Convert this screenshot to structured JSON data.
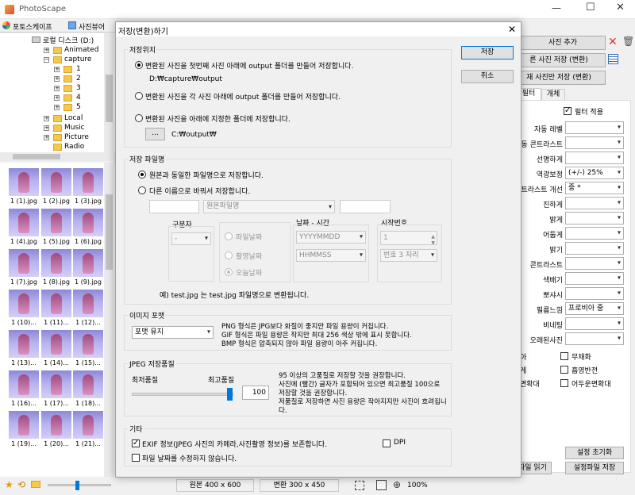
{
  "app": {
    "title": "PhotoScape",
    "tabs": [
      "포토스케이프",
      "사진뷰어"
    ]
  },
  "tree": {
    "drive": "로컬 디스크 (D:)",
    "items": [
      "Animated",
      "capture",
      "1",
      "2",
      "3",
      "4",
      "5",
      "Local",
      "Music",
      "Picture",
      "Radio"
    ]
  },
  "thumbs": [
    "1 (1).jpg",
    "1 (2).jpg",
    "1 (3).jpg",
    "1 (4).jpg",
    "1 (5).jpg",
    "1 (6).jpg",
    "1 (7).jpg",
    "1 (8).jpg",
    "1 (9).jpg",
    "1 (10)...",
    "1 (11)...",
    "1 (12)...",
    "1 (13)...",
    "1 (14)...",
    "1 (15)...",
    "1 (16)...",
    "1 (17)...",
    "1 (18)...",
    "1 (19)...",
    "1 (20)...",
    "1 (21)..."
  ],
  "status": {
    "original": "원본 400 x 600",
    "converted": "변환 300 x 450",
    "zoom": "100%"
  },
  "right": {
    "buttons": [
      "사진 추가",
      "른 사진 저장 (변환)",
      "재 사진만 저장 (변환)"
    ],
    "tabs": [
      "필터",
      "개체"
    ],
    "filter_check": "필터 적용",
    "rows": [
      {
        "label": "자동 레벨",
        "value": ""
      },
      {
        "label": "동 콘트라스트",
        "value": ""
      },
      {
        "label": "선명하게",
        "value": ""
      },
      {
        "label": "역광보정",
        "value": "(+/-) 25%"
      },
      {
        "label": "콘트라스트 개선",
        "value": "중 *"
      },
      {
        "label": "진하게",
        "value": ""
      },
      {
        "label": "밝게",
        "value": ""
      },
      {
        "label": "어둡게",
        "value": ""
      },
      {
        "label": "밝기",
        "value": ""
      },
      {
        "label": "콘트라스트",
        "value": ""
      },
      {
        "label": "색배기",
        "value": ""
      },
      {
        "label": "뽀샤시",
        "value": ""
      },
      {
        "label": "필름느낌",
        "value": "프로비아 중"
      },
      {
        "label": "비네팅",
        "value": ""
      },
      {
        "label": "오래된사진",
        "value": ""
      }
    ],
    "checks_left": [
      "아",
      "게",
      "면확대"
    ],
    "checks_right": [
      "무채화",
      "흡영반전",
      "어두운면확대"
    ],
    "bottom_buttons": [
      "설정 초기화",
      "파일 읽기",
      "설정파일 저장"
    ]
  },
  "dialog": {
    "title": "저장(변환)하기",
    "save": "저장",
    "cancel": "취소",
    "location": {
      "title": "저장위치",
      "opt1": "변환된 사진을 첫번째 사진 아래에 output 폴더를 만들어 저장합니다.",
      "path1": "D:₩capture₩output",
      "opt2": "변환된 사진을 각 사진 아래에 output 폴더를 만들어 저장합니다.",
      "opt3": "변환된 사진을 아래에 지정한 폴더에 저장합니다.",
      "browse": "...",
      "path3": "C:₩output₩"
    },
    "filename": {
      "title": "저장 파일명",
      "opt1": "원본과 동일한 파일명으로 저장합니다.",
      "opt2": "다른 이름으로 바꿔서 저장합니다.",
      "prefix": "",
      "name_select": "원본파일명",
      "suffix": "",
      "sep_title": "구분자",
      "sep_value": "-",
      "date_radios": [
        "파일날짜",
        "촬영날짜",
        "오늘날짜"
      ],
      "datetime_title": "날짜 - 시간",
      "date_format": "YYYYMMDD",
      "time_format": "HHMMSS",
      "start_title": "시작번호",
      "start_value": "1",
      "digits": "번호 3 자리",
      "example": "예) test.jpg 는 test.jpg  파일명으로 변환됩니다."
    },
    "format": {
      "title": "이미지 포맷",
      "value": "포맷 유지",
      "desc": [
        "PNG 형식은 JPG보다 화질이 좋지만 파일 용량이 커집니다.",
        "GIF 형식은 파일 용량은 작지만 최대 256 색상 밖에 표시 못합니다.",
        "BMP 형식은 압축되지 않아 파일 용량이 아주 커집니다."
      ]
    },
    "jpeg": {
      "title": "JPEG 저장품질",
      "min": "최저품질",
      "max": "최고품질",
      "value": "100",
      "level": 1.0,
      "desc": [
        "95 이상의 고품질로 저장할 것을 권장합니다.",
        "사진에 (빨간) 글자가 포함되어 있으면 최고품질 100으로",
        "저장할 것을 권장합니다.",
        "저품질로 저장하면 사진 용량은 작아지지만 사진이 흐려집니",
        "다."
      ]
    },
    "misc": {
      "title": "기타",
      "exif": "EXIF 정보(JPEG 사진의 카메라,사진촬영 정보)를 보존합니다.",
      "dpi": "DPI",
      "keepdate": "파일 날짜를 수정하지 않습니다."
    }
  }
}
